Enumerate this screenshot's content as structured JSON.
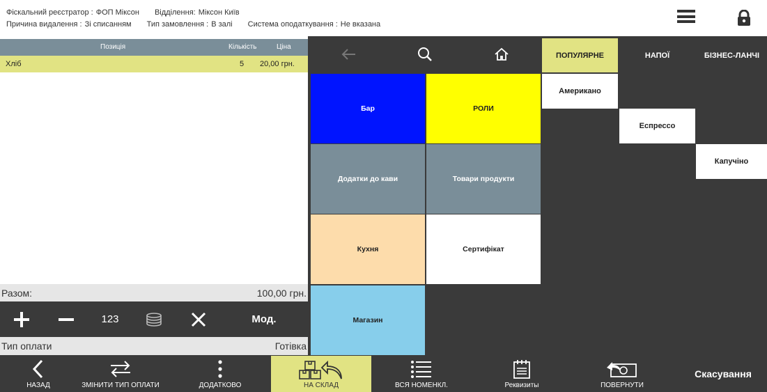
{
  "header": {
    "fiscal_label": "Фіскальний реєстратор :",
    "fiscal_value": "ФОП Міксон",
    "branch_label": "Відділення:",
    "branch_value": "Міксон Київ",
    "deletion_reason_label": "Причина видалення :",
    "deletion_reason_value": "Зі списанням",
    "order_type_label": "Тип замовлення :",
    "order_type_value": "В залі",
    "tax_system_label": "Система оподаткування :",
    "tax_system_value": "Не вказана"
  },
  "order_table": {
    "columns": [
      "Позиція",
      "Кількість",
      "Ціна"
    ],
    "rows": [
      {
        "position": "Хліб",
        "quantity": "5",
        "price": "20,00 грн."
      }
    ]
  },
  "summary": {
    "total_label": "Разом:",
    "total_value": "100,00 грн.",
    "payment_type_label": "Тип оплати",
    "payment_type_value": "Готівка"
  },
  "toolbar": {
    "quantity_label": "123",
    "modifier_label": "Мод."
  },
  "tabs": [
    {
      "label": "ПОПУЛЯРНЕ",
      "active": true
    },
    {
      "label": "НАПОЇ",
      "active": false
    },
    {
      "label": "БІЗНЕС-ЛАНЧІ",
      "active": false
    }
  ],
  "categories": [
    {
      "label": "Бар",
      "color": "#0014ff",
      "text_color": "#ffffff"
    },
    {
      "label": "РОЛИ",
      "color": "#ffff00",
      "text_color": "#222222"
    },
    {
      "label": "Додатки до кави",
      "color": "#7a8e99",
      "text_color": "#ffffff"
    },
    {
      "label": "Товари продукти",
      "color": "#7a8e99",
      "text_color": "#ffffff"
    },
    {
      "label": "Кухня",
      "color": "#fddcab",
      "text_color": "#222222"
    },
    {
      "label": "Сертифікат",
      "color": "#ffffff",
      "text_color": "#222222"
    },
    {
      "label": "Магазин",
      "color": "#87ceeb",
      "text_color": "#222222"
    }
  ],
  "products": [
    {
      "label": "Американо"
    },
    {
      "label": "Еспрессо"
    },
    {
      "label": "Капучіно"
    }
  ],
  "bottom_bar": {
    "back_label": "НАЗАД",
    "change_payment_label": "ЗМІНИТИ ТИП ОПЛАТИ",
    "more_label": "ДОДАТКОВО",
    "to_warehouse_label": "НА СКЛАД",
    "all_items_label": "ВСЯ НОМЕНКЛ.",
    "requisites_label": "Реквизиты",
    "return_label": "ПОВЕРНУТИ",
    "cancel_label": "Скасування"
  },
  "colors": {
    "accent_yellow": "#e1e383",
    "dark_bg": "#3a3a3a",
    "table_header": "#7a8e99"
  }
}
